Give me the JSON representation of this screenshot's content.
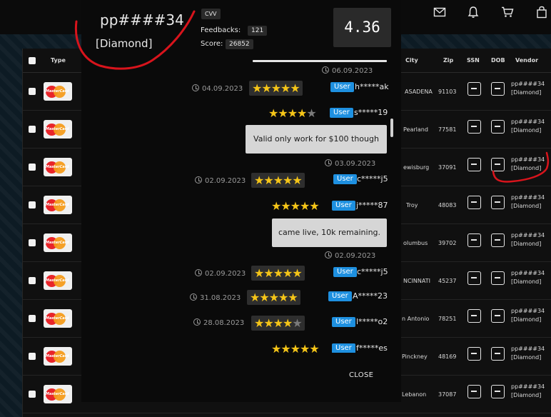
{
  "nav": {
    "icons": [
      "mail-icon",
      "bell-icon",
      "cart-icon",
      "bag-icon"
    ]
  },
  "table": {
    "headers": {
      "type": "Type",
      "city": "City",
      "zip": "Zip",
      "ssn": "SSN",
      "dob": "DOB",
      "vendor": "Vendor"
    },
    "rows": [
      {
        "city": "ASADENA",
        "zip": "91103",
        "vendor_name": "pp####34",
        "vendor_rank": "[Diamond]"
      },
      {
        "city": "Pearland",
        "zip": "77581",
        "vendor_name": "pp####34",
        "vendor_rank": "[Diamond]"
      },
      {
        "city": "ewisburg",
        "zip": "37091",
        "vendor_name": "pp####34",
        "vendor_rank": "[Diamond]"
      },
      {
        "city": "Troy",
        "zip": "48083",
        "vendor_name": "pp####34",
        "vendor_rank": "[Diamond]"
      },
      {
        "city": "olumbus",
        "zip": "39702",
        "vendor_name": "pp####34",
        "vendor_rank": "[Diamond]"
      },
      {
        "city": "NCINNATI",
        "zip": "45237",
        "vendor_name": "pp####34",
        "vendor_rank": "[Diamond]"
      },
      {
        "city": "n Antonio",
        "zip": "78251",
        "vendor_name": "pp####34",
        "vendor_rank": "[Diamond]"
      },
      {
        "city": "Pinckney",
        "zip": "48169",
        "vendor_name": "pp####34",
        "vendor_rank": "[Diamond]"
      },
      {
        "city": "Lebanon",
        "zip": "37087",
        "vendor_name": "pp####34",
        "vendor_rank": "[Diamond]"
      }
    ],
    "card_text": "MasterCard"
  },
  "modal": {
    "seller_name": "pp####34",
    "seller_rank": "[Diamond]",
    "tag": "CVV",
    "feedbacks_label": "Feedbacks:",
    "feedbacks_value": "121",
    "score_label": "Score:",
    "score_value": "26852",
    "rating": "4.36",
    "close_label": "CLOSE",
    "feed": [
      {
        "kind": "date",
        "text": "06.09.2023"
      },
      {
        "kind": "review",
        "date": "04.09.2023",
        "stars": 5,
        "badge": "User",
        "user": "h*****ak"
      },
      {
        "kind": "review",
        "date": "",
        "stars": 4,
        "badge": "User",
        "user": "s*****19"
      },
      {
        "kind": "comment",
        "text": "Valid only work for $100 though"
      },
      {
        "kind": "date",
        "text": "03.09.2023"
      },
      {
        "kind": "review",
        "date": "02.09.2023",
        "stars": 5,
        "badge": "User",
        "user": "c*****j5"
      },
      {
        "kind": "review",
        "date": "",
        "stars": 5,
        "badge": "User",
        "user": "j*****87"
      },
      {
        "kind": "comment",
        "text": "came live, 10k remaining."
      },
      {
        "kind": "date",
        "text": "02.09.2023"
      },
      {
        "kind": "review",
        "date": "02.09.2023",
        "stars": 5,
        "badge": "User",
        "user": "c*****j5"
      },
      {
        "kind": "review",
        "date": "31.08.2023",
        "stars": 5,
        "badge": "User",
        "user": "A*****23"
      },
      {
        "kind": "review",
        "date": "28.08.2023",
        "stars": 4,
        "badge": "User",
        "user": "l*****o2"
      },
      {
        "kind": "review",
        "date": "",
        "stars": 5,
        "badge": "User",
        "user": "f*****es"
      }
    ]
  },
  "colors": {
    "annotation": "#d8141c",
    "user_badge": "#1e90e0",
    "star": "#f5c518"
  }
}
